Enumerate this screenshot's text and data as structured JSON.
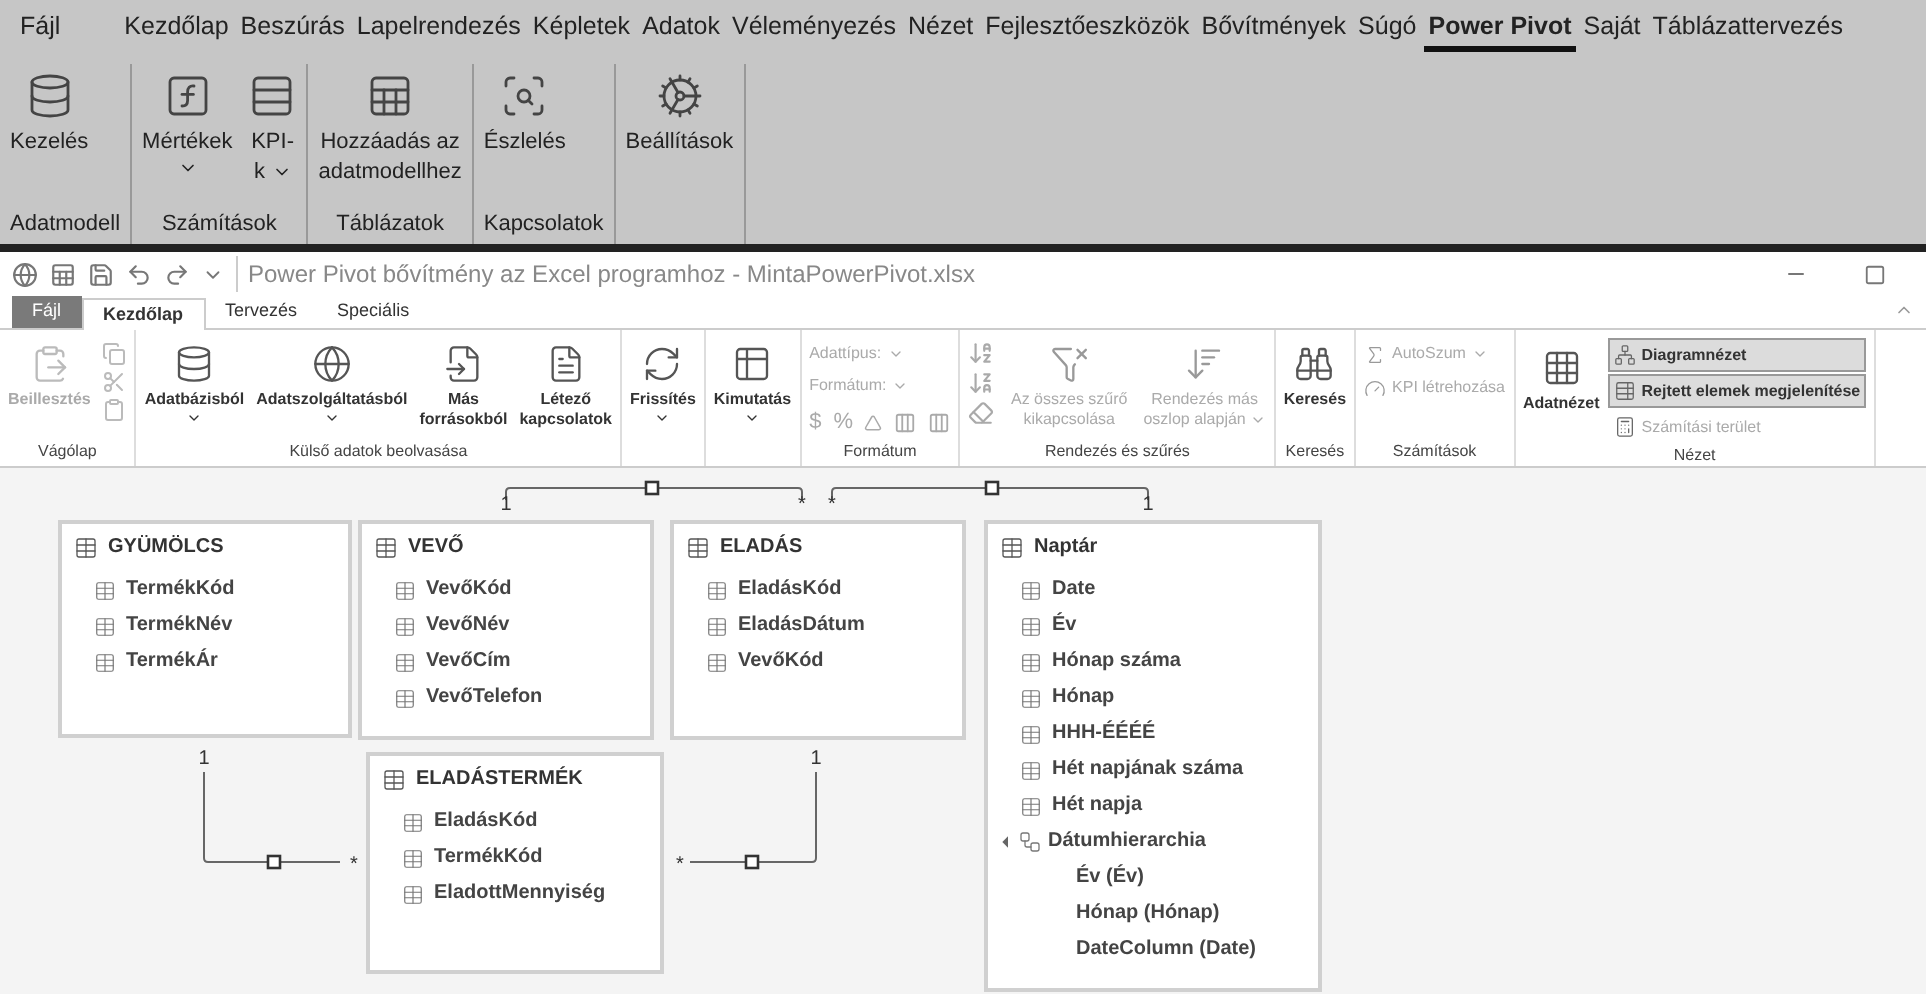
{
  "excel_ribbon": {
    "tabs": [
      {
        "label": "Fájl",
        "selected": false
      },
      {
        "label": "Kezdőlap",
        "selected": false
      },
      {
        "label": "Beszúrás",
        "selected": false
      },
      {
        "label": "Lapelrendezés",
        "selected": false
      },
      {
        "label": "Képletek",
        "selected": false
      },
      {
        "label": "Adatok",
        "selected": false
      },
      {
        "label": "Véleményezés",
        "selected": false
      },
      {
        "label": "Nézet",
        "selected": false
      },
      {
        "label": "Fejlesztőeszközök",
        "selected": false
      },
      {
        "label": "Bővítmények",
        "selected": false
      },
      {
        "label": "Súgó",
        "selected": false
      },
      {
        "label": "Power Pivot",
        "selected": true
      },
      {
        "label": "Saját",
        "selected": false
      },
      {
        "label": "Táblázattervezés",
        "selected": false
      }
    ],
    "groups": [
      {
        "label": "Adatmodell",
        "buttons": [
          {
            "kind": "manage",
            "lines": [
              "Kezelés"
            ],
            "menu": false
          }
        ]
      },
      {
        "label": "Számítások",
        "buttons": [
          {
            "kind": "measures",
            "lines": [
              "Mértékek"
            ],
            "menu": true
          },
          {
            "kind": "kpi",
            "lines": [
              "KPI-",
              "k"
            ],
            "menu": true
          }
        ]
      },
      {
        "label": "Táblázatok",
        "buttons": [
          {
            "kind": "add_table",
            "lines": [
              "Hozzáadás az",
              "adatmodellhez"
            ],
            "menu": false
          }
        ]
      },
      {
        "label": "Kapcsolatok",
        "buttons": [
          {
            "kind": "detect",
            "lines": [
              "Észlelés"
            ],
            "menu": false
          }
        ]
      },
      {
        "buttons": [
          {
            "kind": "settings",
            "lines": [
              "Beállítások"
            ],
            "menu": false
          }
        ]
      }
    ]
  },
  "power_pivot": {
    "title": "Power Pivot bővítmény az Excel programhoz - MintaPowerPivot.xlsx",
    "tabs": [
      {
        "label": "Fájl",
        "kind": "file",
        "selected": false
      },
      {
        "label": "Kezdőlap",
        "kind": "tab",
        "selected": true
      },
      {
        "label": "Tervezés",
        "kind": "tab",
        "selected": false
      },
      {
        "label": "Speciális",
        "kind": "tab",
        "selected": false
      }
    ],
    "groups": [
      {
        "label": "Vágólap",
        "kind": "clipboard",
        "items": [
          {
            "kind": "paste",
            "lines": [
              "Beillesztés"
            ],
            "disabled": true,
            "menu": false
          }
        ]
      },
      {
        "label": "Külső adatok beolvasása",
        "kind": "large",
        "items": [
          {
            "kind": "database",
            "lines": [
              "Adatbázisból"
            ],
            "disabled": false,
            "menu": true
          },
          {
            "kind": "data_service",
            "lines": [
              "Adatszolgáltatásból"
            ],
            "disabled": false,
            "menu": true
          },
          {
            "kind": "other_sources",
            "lines": [
              "Más",
              "forrásokból"
            ],
            "disabled": false,
            "menu": false
          },
          {
            "kind": "existing",
            "lines": [
              "Létező",
              "kapcsolatok"
            ],
            "disabled": false,
            "menu": false
          }
        ]
      },
      {
        "kind": "large",
        "items": [
          {
            "kind": "refresh",
            "lines": [
              "Frissítés"
            ],
            "disabled": false,
            "menu": true
          }
        ]
      },
      {
        "kind": "large",
        "items": [
          {
            "kind": "pivot",
            "lines": [
              "Kimutatás"
            ],
            "disabled": false,
            "menu": true
          }
        ]
      },
      {
        "label": "Formátum",
        "kind": "format",
        "items": [
          {
            "kind": "field",
            "lines": [
              "Adattípus:"
            ],
            "disabled": true,
            "menu": true
          },
          {
            "kind": "field",
            "lines": [
              "Formátum:"
            ],
            "disabled": true,
            "menu": true
          },
          {
            "kind": "symbols",
            "lines": [
              "$",
              "%"
            ],
            "disabled": true
          }
        ]
      },
      {
        "label": "Rendezés és szűrés",
        "kind": "sort",
        "items": [
          {
            "kind": "filter_off",
            "lines": [
              "Az összes szűrő",
              "kikapcsolása"
            ],
            "disabled": true,
            "menu": false
          },
          {
            "kind": "sort_by",
            "lines": [
              "Rendezés más",
              "oszlop alapján"
            ],
            "disabled": true,
            "menu": true
          }
        ]
      },
      {
        "label": "Keresés",
        "kind": "large",
        "items": [
          {
            "kind": "find",
            "lines": [
              "Keresés"
            ],
            "disabled": false,
            "menu": false
          }
        ]
      },
      {
        "label": "Számítások",
        "kind": "small",
        "items": [
          {
            "kind": "autosum",
            "lines": [
              "AutoSzum"
            ],
            "disabled": true,
            "menu": true
          },
          {
            "kind": "kpi",
            "lines": [
              "KPI létrehozása"
            ],
            "disabled": true,
            "menu": false
          }
        ]
      },
      {
        "label": "Nézet",
        "kind": "view",
        "items": [
          {
            "kind": "data_view",
            "lines": [
              "Adatnézet"
            ],
            "disabled": false,
            "menu": false
          },
          {
            "kind": "diagram",
            "lines": [
              "Diagramnézet"
            ],
            "disabled": false,
            "menu": false,
            "selected": true
          },
          {
            "kind": "hidden",
            "lines": [
              "Rejtett elemek megjelenítése"
            ],
            "disabled": false,
            "menu": false,
            "selected": true
          },
          {
            "kind": "calc_area",
            "lines": [
              "Számítási terület"
            ],
            "disabled": true,
            "menu": false,
            "selected": false
          }
        ]
      }
    ],
    "diagram": {
      "tables": [
        {
          "name": "GYÜMÖLCS",
          "columns": [
            "TermékKód",
            "TermékNév",
            "TermékÁr"
          ]
        },
        {
          "name": "VEVŐ",
          "columns": [
            "VevőKód",
            "VevőNév",
            "VevőCím",
            "VevőTelefon"
          ]
        },
        {
          "name": "ELADÁS",
          "columns": [
            "EladásKód",
            "EladásDátum",
            "VevőKód"
          ]
        },
        {
          "name": "Naptár",
          "columns": [
            "Date",
            "Év",
            "Hónap száma",
            "Hónap",
            "HHH-ÉÉÉÉ",
            "Hét napjának száma",
            "Hét napja"
          ],
          "hierarchies": [
            {
              "name": "Dátumhierarchia",
              "expanded": true,
              "levels": [
                "Év (Év)",
                "Hónap (Hónap)",
                "DateColumn (Date)"
              ]
            }
          ]
        },
        {
          "name": "ELADÁSTERMÉK",
          "columns": [
            "EladásKód",
            "TermékKód",
            "EladottMennyiség"
          ]
        }
      ],
      "relationships": [
        {
          "one": "1",
          "many": "*"
        },
        {
          "one": "1",
          "many": "*"
        },
        {
          "one": "1",
          "many": "*"
        },
        {
          "one": "1",
          "many": "*"
        }
      ]
    }
  }
}
